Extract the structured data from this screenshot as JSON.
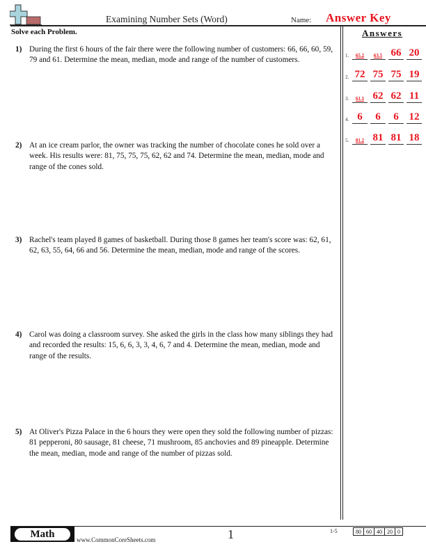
{
  "header": {
    "title": "Examining Number Sets (Word)",
    "name_label": "Name:",
    "name_value": "Answer Key",
    "logo_icon": "plus-minus-logo-icon"
  },
  "instructions": "Solve each Problem.",
  "answers_heading": "Answers",
  "problems": [
    {
      "number": "1)",
      "text": "During the first 6 hours of the fair there were the following number of customers: 66, 66, 60, 59, 79 and 61. Determine the mean, median, mode and range of the number of customers."
    },
    {
      "number": "2)",
      "text": "At an ice cream parlor, the owner was tracking the number of chocolate cones he sold over a week. His results were: 81, 75, 75, 75, 62, 62 and 74. Determine the mean, median, mode and range of the cones sold."
    },
    {
      "number": "3)",
      "text": "Rachel's team played 8 games of basketball. During those 8 games her team's score was: 62, 61, 62, 63, 55, 64, 66 and 56. Determine the mean, median, mode and range of the scores."
    },
    {
      "number": "4)",
      "text": "Carol was doing a classroom survey. She asked the girls in the class how many siblings they had and recorded the results: 15, 6, 6, 3, 3, 4, 6, 7 and 4. Determine the mean, median, mode and range of the results."
    },
    {
      "number": "5)",
      "text": "At Oliver's Pizza Palace in the 6 hours they were open they sold the following number of pizzas: 81 pepperoni, 80 sausage, 81 cheese, 71 mushroom, 85 anchovies and 89 pineapple. Determine the mean, median, mode and range of the number of pizzas sold."
    }
  ],
  "answers": [
    {
      "index": "1.",
      "values": [
        "65.2",
        "63.5",
        "66",
        "20"
      ]
    },
    {
      "index": "2.",
      "values": [
        "72",
        "75",
        "75",
        "19"
      ]
    },
    {
      "index": "3.",
      "values": [
        "61.1",
        "62",
        "62",
        "11"
      ]
    },
    {
      "index": "4.",
      "values": [
        "6",
        "6",
        "6",
        "12"
      ]
    },
    {
      "index": "5.",
      "values": [
        "81.2",
        "81",
        "81",
        "18"
      ]
    }
  ],
  "footer": {
    "subject": "Math",
    "site": "www.CommonCoreSheets.com",
    "page": "1",
    "score_range": "1-5",
    "scores": [
      "80",
      "60",
      "40",
      "20",
      "0"
    ]
  },
  "colors": {
    "answer": "#e8141e",
    "logo_plus": "#a9d4de",
    "logo_minus": "#b86b6b"
  }
}
